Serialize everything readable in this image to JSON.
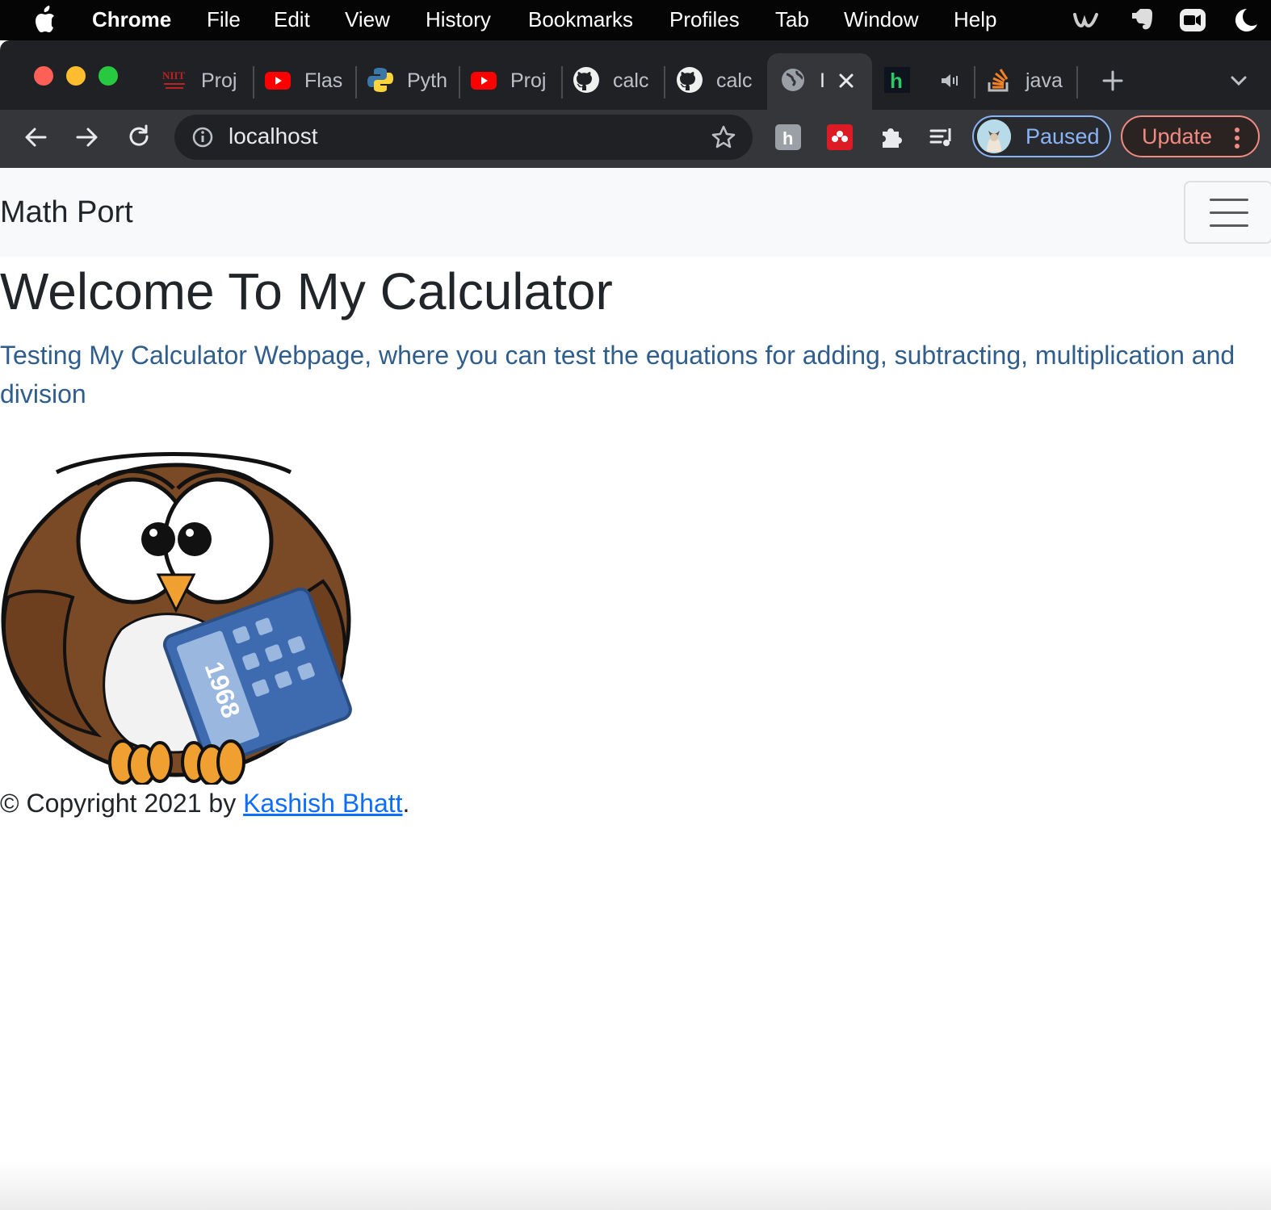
{
  "menubar": {
    "app": "Chrome",
    "items": [
      "File",
      "Edit",
      "View",
      "History",
      "Bookmarks",
      "Profiles",
      "Tab",
      "Window",
      "Help"
    ],
    "tray_icons": [
      "webex-icon",
      "evernote-icon",
      "zoom-icon",
      "moon-icon"
    ]
  },
  "tabs": [
    {
      "title": "Proj",
      "icon": "nmit-icon"
    },
    {
      "title": "Flas",
      "icon": "youtube-icon"
    },
    {
      "title": "Pyth",
      "icon": "python-icon"
    },
    {
      "title": "Proj",
      "icon": "youtube-icon"
    },
    {
      "title": "calc",
      "icon": "github-icon"
    },
    {
      "title": "calc",
      "icon": "github-icon"
    },
    {
      "title": "I",
      "icon": "globe-icon",
      "active": true
    },
    {
      "title": "H",
      "icon": "hackerrank-icon",
      "audio": true
    },
    {
      "title": "java",
      "icon": "stackoverflow-icon"
    }
  ],
  "toolbar": {
    "url": "localhost",
    "profile_label": "Paused",
    "update_label": "Update"
  },
  "page": {
    "brand": "Math Port",
    "heading": "Welcome To My Calculator",
    "lead": "Testing My Calculator Webpage, where you can test the equations for adding, subtracting, multiplication and division",
    "image_alt": "owl holding calculator",
    "calculator_display": "1968",
    "footer_prefix": "© Copyright 2021 by ",
    "footer_link": "Kashish Bhatt",
    "footer_suffix": "."
  },
  "colors": {
    "navbar_bg": "#f8f9fa",
    "lead_text": "#2f5d8c",
    "link": "#0d6efd",
    "profile_accent": "#8ab4f8",
    "update_accent": "#f28b82"
  }
}
